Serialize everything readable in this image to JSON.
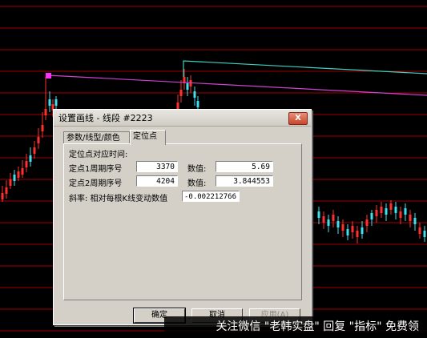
{
  "dialog": {
    "title": "设置画线 - 线段 #2223",
    "close_label": "X",
    "tabs": [
      {
        "label": "参数/线型/颜色",
        "active": false
      },
      {
        "label": "定位点",
        "active": true
      }
    ],
    "section_label": "定位点对应时间:",
    "point1": {
      "label": "定点1周期序号",
      "period": "3370",
      "value_label": "数值:",
      "value": "5.69"
    },
    "point2": {
      "label": "定点2周期序号",
      "period": "4204",
      "value_label": "数值:",
      "value": "3.844553"
    },
    "slope": {
      "label": "斜率: 相对每根K线变动数值",
      "value": "-0.002212766"
    },
    "buttons": {
      "ok": "确定",
      "cancel": "取消",
      "apply": "应用(A)"
    }
  },
  "watermark": "关注微信 \"老韩实盘\" 回复 \"指标\" 免费领",
  "colors": {
    "gridline": "#a00000",
    "trend_magenta": "#d040d0",
    "trend_cyan": "#40d0c0",
    "candle_up": "#ff3030",
    "candle_down": "#40e0f0",
    "dialog_bg": "#d4d0c8"
  }
}
